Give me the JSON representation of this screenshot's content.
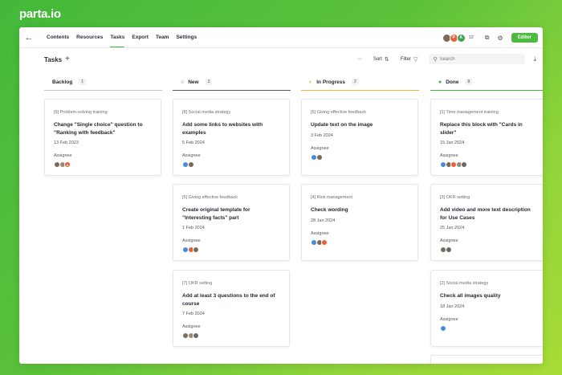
{
  "brand": "parta.io",
  "nav": {
    "back_icon": "arrow-left-icon",
    "items": [
      "Contents",
      "Resources",
      "Tasks",
      "Export",
      "Team",
      "Settings"
    ],
    "active": "Tasks"
  },
  "header": {
    "member_count": "12",
    "editor_label": "Editor",
    "avatars": [
      {
        "initial": "",
        "color": "#7a6a5a"
      },
      {
        "initial": "P",
        "color": "#e2603a"
      },
      {
        "initial": "A",
        "color": "#3aa55a"
      }
    ]
  },
  "toolbar": {
    "title": "Tasks",
    "sort_label": "Sort",
    "filter_label": "Filter",
    "search_placeholder": "Search"
  },
  "columns": [
    {
      "name": "Backlog",
      "count": "1",
      "color": "#c8c8cc",
      "status_icon": "",
      "cards": [
        {
          "tag": "[9] Problem-solving training",
          "title": "Change \"Single choice\" question to \"Ranking with feedback\"",
          "date": "13 Feb 2023",
          "assignee": "Assignee",
          "avatars": [
            {
              "i": "",
              "c": "#7a6a5a"
            },
            {
              "i": "",
              "c": "#9a8a7a"
            },
            {
              "i": "A",
              "c": "#e2603a"
            }
          ]
        }
      ]
    },
    {
      "name": "New",
      "count": "3",
      "color": "#555a66",
      "status_icon": "○",
      "cards": [
        {
          "tag": "[8] Social media strategy",
          "title": "Add some links to websites with examples",
          "date": "5 Feb 2024",
          "assignee": "Assignee",
          "avatars": [
            {
              "i": "",
              "c": "#4a8ad8"
            },
            {
              "i": "",
              "c": "#7a6a5a"
            }
          ]
        },
        {
          "tag": "[5] Giving effective feedback",
          "title": "Create original template for \"Interesting facts\" part",
          "date": "1 Feb 2024",
          "assignee": "Assignee",
          "avatars": [
            {
              "i": "",
              "c": "#4a8ad8"
            },
            {
              "i": "",
              "c": "#e2603a"
            },
            {
              "i": "",
              "c": "#7a6a5a"
            }
          ]
        },
        {
          "tag": "[7] OKR setting",
          "title": "Add at least 3 questions to the end of course",
          "date": "7 Feb 2024",
          "assignee": "Assignee",
          "avatars": [
            {
              "i": "",
              "c": "#7a6a5a"
            },
            {
              "i": "",
              "c": "#9a8a7a"
            },
            {
              "i": "",
              "c": "#6a6a6a"
            }
          ]
        }
      ]
    },
    {
      "name": "In Progress",
      "count": "2",
      "color": "#f2b430",
      "status_icon": "◐",
      "cards": [
        {
          "tag": "[6] Giving effective feedback",
          "title": "Update text on the image",
          "date": "3 Feb 2024",
          "assignee": "Assignee",
          "avatars": [
            {
              "i": "",
              "c": "#4a8ad8"
            },
            {
              "i": "",
              "c": "#7a6a5a"
            }
          ]
        },
        {
          "tag": "[4] Risk management",
          "title": "Check wording",
          "date": "28 Jan 2024",
          "assignee": "Assignee",
          "avatars": [
            {
              "i": "",
              "c": "#4a8ad8"
            },
            {
              "i": "",
              "c": "#7a6a5a"
            },
            {
              "i": "",
              "c": "#e2603a"
            }
          ]
        }
      ]
    },
    {
      "name": "Done",
      "count": "8",
      "color": "#3cb43c",
      "status_icon": "●",
      "cards": [
        {
          "tag": "[1] Time management training",
          "title": "Replace this block with \"Cards in slider\"",
          "date": "15 Jan 2024",
          "assignee": "Assignee",
          "avatars": [
            {
              "i": "",
              "c": "#4a8ad8"
            },
            {
              "i": "",
              "c": "#7a6a5a"
            },
            {
              "i": "",
              "c": "#e2603a"
            },
            {
              "i": "",
              "c": "#9a8a7a"
            },
            {
              "i": "",
              "c": "#6a6a6a"
            }
          ]
        },
        {
          "tag": "[3] OKR setting",
          "title": "Add video and more text description for Use Cases",
          "date": "25 Jan 2024",
          "assignee": "Assignee",
          "avatars": [
            {
              "i": "",
              "c": "#7a6a5a"
            },
            {
              "i": "",
              "c": "#6a6a6a"
            }
          ]
        },
        {
          "tag": "[2] Social media strategy",
          "title": "Check all images quality",
          "date": "18 Jan 2024",
          "assignee": "Assignee",
          "avatars": [
            {
              "i": "",
              "c": "#4a8ad8"
            }
          ]
        }
      ]
    }
  ]
}
